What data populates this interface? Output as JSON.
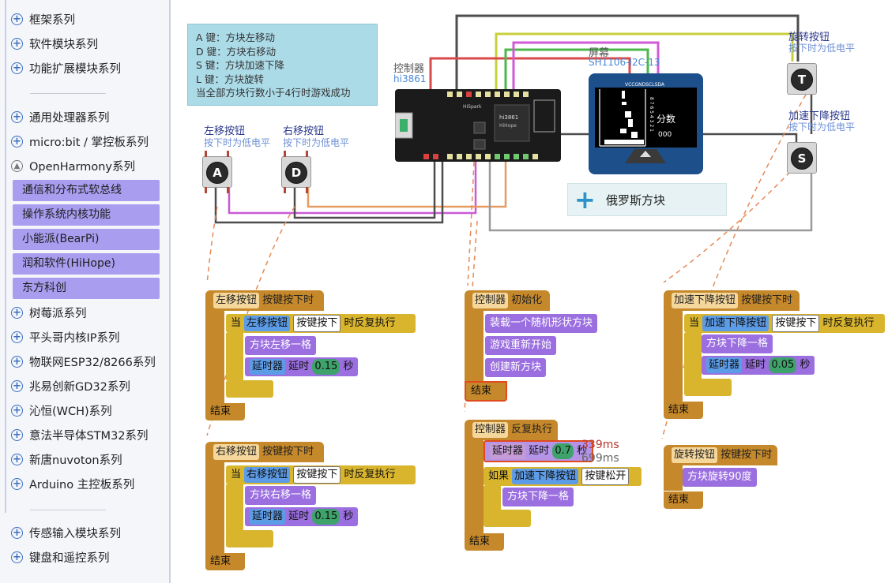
{
  "sidebar": {
    "items_top": [
      {
        "label": "框架系列",
        "icon": "plus-circle-icon"
      },
      {
        "label": "软件模块系列",
        "icon": "plus-circle-icon"
      },
      {
        "label": "功能扩展模块系列",
        "icon": "plus-circle-icon"
      }
    ],
    "items_mid": [
      {
        "label": "通用处理器系列",
        "icon": "plus-circle-icon"
      },
      {
        "label": "micro:bit / 掌控板系列",
        "icon": "plus-circle-icon"
      },
      {
        "label": "OpenHarmony系列",
        "icon": "collapse-circle-icon"
      }
    ],
    "subitems": [
      "通信和分布式软总线",
      "操作系统内核功能",
      "小能派(BearPi)",
      "润和软件(HiHope)",
      "东方科创"
    ],
    "items_after": [
      {
        "label": "树莓派系列",
        "icon": "plus-circle-icon"
      },
      {
        "label": "平头哥内核IP系列",
        "icon": "plus-circle-icon"
      },
      {
        "label": "物联网ESP32/8266系列",
        "icon": "plus-circle-icon"
      },
      {
        "label": "兆易创新GD32系列",
        "icon": "plus-circle-icon"
      },
      {
        "label": "沁恒(WCH)系列",
        "icon": "plus-circle-icon"
      },
      {
        "label": "意法半导体STM32系列",
        "icon": "plus-circle-icon"
      },
      {
        "label": "新唐nuvoton系列",
        "icon": "plus-circle-icon"
      },
      {
        "label": "Arduino 主控板系列",
        "icon": "plus-circle-icon"
      }
    ],
    "items_bottom": [
      {
        "label": "传感输入模块系列",
        "icon": "plus-circle-icon"
      },
      {
        "label": "键盘和遥控系列",
        "icon": "plus-circle-icon"
      }
    ]
  },
  "note": {
    "lines": [
      "A 键：方块左移动",
      "D 键：方块右移动",
      "S 键：方块加速下降",
      "L 键：方块旋转",
      "当全部方块行数小于4行时游戏成功"
    ]
  },
  "hardware": {
    "controller_label": "控制器",
    "controller_model": "hi3861",
    "screen_label": "屏幕",
    "screen_model": "SH1106-I2C-13",
    "board_brand": "HiSpark",
    "chip_name": "hi3861",
    "chip_vendor": "HiHope",
    "pins": "VCCGNDSCLSDA",
    "oled_score_label": "分数",
    "oled_score_digits": "8 7 6 5 4 3 2 1",
    "oled_score_value": "000",
    "left_button": {
      "title": "左移按钮",
      "hint": "按下时为低电平",
      "key": "A"
    },
    "right_button": {
      "title": "右移按钮",
      "hint": "按下时为低电平",
      "key": "D"
    },
    "rotate_button": {
      "title": "旋转按钮",
      "hint": "按下时为低电平",
      "key": "T"
    },
    "fast_button": {
      "title": "加速下降按钮",
      "hint": "按下时为低电平",
      "key": "S"
    }
  },
  "tetris_module": {
    "label": "俄罗斯方块"
  },
  "blocks": {
    "left": {
      "hat_name": "左移按钮",
      "hat_event": "按键按下时",
      "when": "当",
      "cond_name": "左移按钮",
      "cond_state": "按键按下",
      "repeat": "时反复执行",
      "action": "方块左移一格",
      "delay_name": "延时器",
      "delay_label": "延时",
      "delay_value": "0.15",
      "unit": "秒",
      "end": "结束"
    },
    "right": {
      "hat_name": "右移按钮",
      "hat_event": "按键按下时",
      "when": "当",
      "cond_name": "右移按钮",
      "cond_state": "按键按下",
      "repeat": "时反复执行",
      "action": "方块右移一格",
      "delay_name": "延时器",
      "delay_label": "延时",
      "delay_value": "0.15",
      "unit": "秒",
      "end": "结束"
    },
    "init": {
      "hat_name": "控制器",
      "hat_event": "初始化",
      "a1": "装载一个随机形状方块",
      "a2": "游戏重新开始",
      "a3": "创建新方块",
      "end": "结束"
    },
    "loop": {
      "hat_name": "控制器",
      "hat_event": "反复执行",
      "delay_name": "延时器",
      "delay_label": "延时",
      "delay_value": "0.7",
      "unit": "秒",
      "time1": "339ms",
      "time2": "699ms",
      "if": "如果",
      "cond_name": "加速下降按钮",
      "cond_state": "按键松开",
      "action": "方块下降一格",
      "end": "结束"
    },
    "fast": {
      "hat_name": "加速下降按钮",
      "hat_event": "按键按下时",
      "when": "当",
      "cond_name": "加速下降按钮",
      "cond_state": "按键按下",
      "repeat": "时反复执行",
      "action": "方块下降一格",
      "delay_name": "延时器",
      "delay_label": "延时",
      "delay_value": "0.05",
      "unit": "秒",
      "end": "结束"
    },
    "rotate": {
      "hat_name": "旋转按钮",
      "hat_event": "按键按下时",
      "action": "方块旋转90度",
      "end": "结束"
    }
  }
}
